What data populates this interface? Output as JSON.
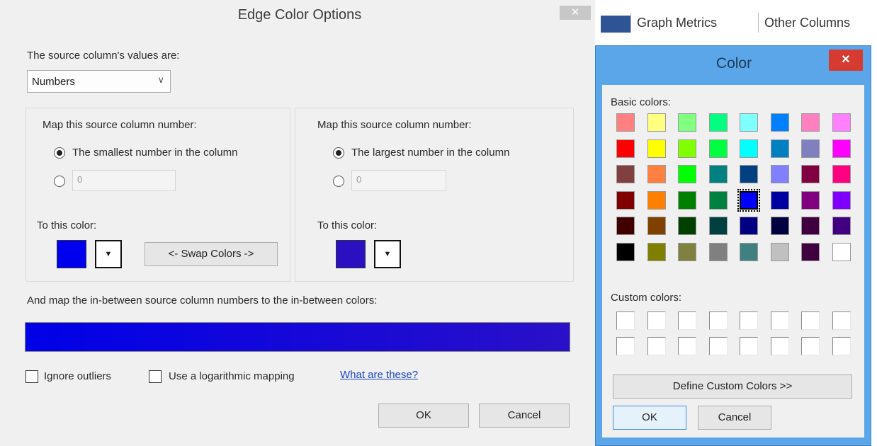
{
  "edge_dialog": {
    "title": "Edge Color Options",
    "close_glyph": "✕",
    "source_values_label": "The source column's values are:",
    "source_values_selected": "Numbers",
    "left_group": {
      "map_label": "Map this source column number:",
      "radio_option": "The smallest number in the column",
      "number_value": "0",
      "to_color_label": "To this color:",
      "swatch_color": "#0000ee"
    },
    "right_group": {
      "map_label": "Map this source column number:",
      "radio_option": "The largest number in the column",
      "number_value": "0",
      "to_color_label": "To this color:",
      "swatch_color": "#2a10c0"
    },
    "swap_button": "<- Swap Colors ->",
    "in_between_label": "And map the in-between source column numbers to the in-between colors:",
    "ignore_outliers": "Ignore outliers",
    "log_mapping": "Use a logarithmic mapping",
    "what_are_these": "What are these?",
    "ok": "OK",
    "cancel": "Cancel",
    "dropdown_glyph": "▼"
  },
  "background_sheet": {
    "tabs": [
      "Graph Metrics",
      "Other Columns"
    ]
  },
  "color_dialog": {
    "title": "Color",
    "close_glyph": "✕",
    "basic_colors_label": "Basic colors:",
    "custom_colors_label": "Custom colors:",
    "define_custom": "Define Custom Colors >>",
    "ok": "OK",
    "cancel": "Cancel",
    "selected_basic_color": "#0000ff",
    "basic_colors": [
      [
        "#ff8080",
        "#ffff80",
        "#80ff80",
        "#00ff80",
        "#80ffff",
        "#0080ff",
        "#ff80c0",
        "#ff80ff"
      ],
      [
        "#ff0000",
        "#ffff00",
        "#80ff00",
        "#00ff40",
        "#00ffff",
        "#0080c0",
        "#8080c0",
        "#ff00ff"
      ],
      [
        "#804040",
        "#ff8040",
        "#00ff00",
        "#008080",
        "#004080",
        "#8080ff",
        "#800040",
        "#ff0080"
      ],
      [
        "#800000",
        "#ff8000",
        "#008000",
        "#008040",
        "#0000ff",
        "#0000a0",
        "#800080",
        "#8000ff"
      ],
      [
        "#400000",
        "#804000",
        "#004000",
        "#004040",
        "#000080",
        "#000040",
        "#400040",
        "#400080"
      ],
      [
        "#000000",
        "#808000",
        "#808040",
        "#808080",
        "#408080",
        "#c0c0c0",
        "#400040",
        "#ffffff"
      ]
    ]
  }
}
